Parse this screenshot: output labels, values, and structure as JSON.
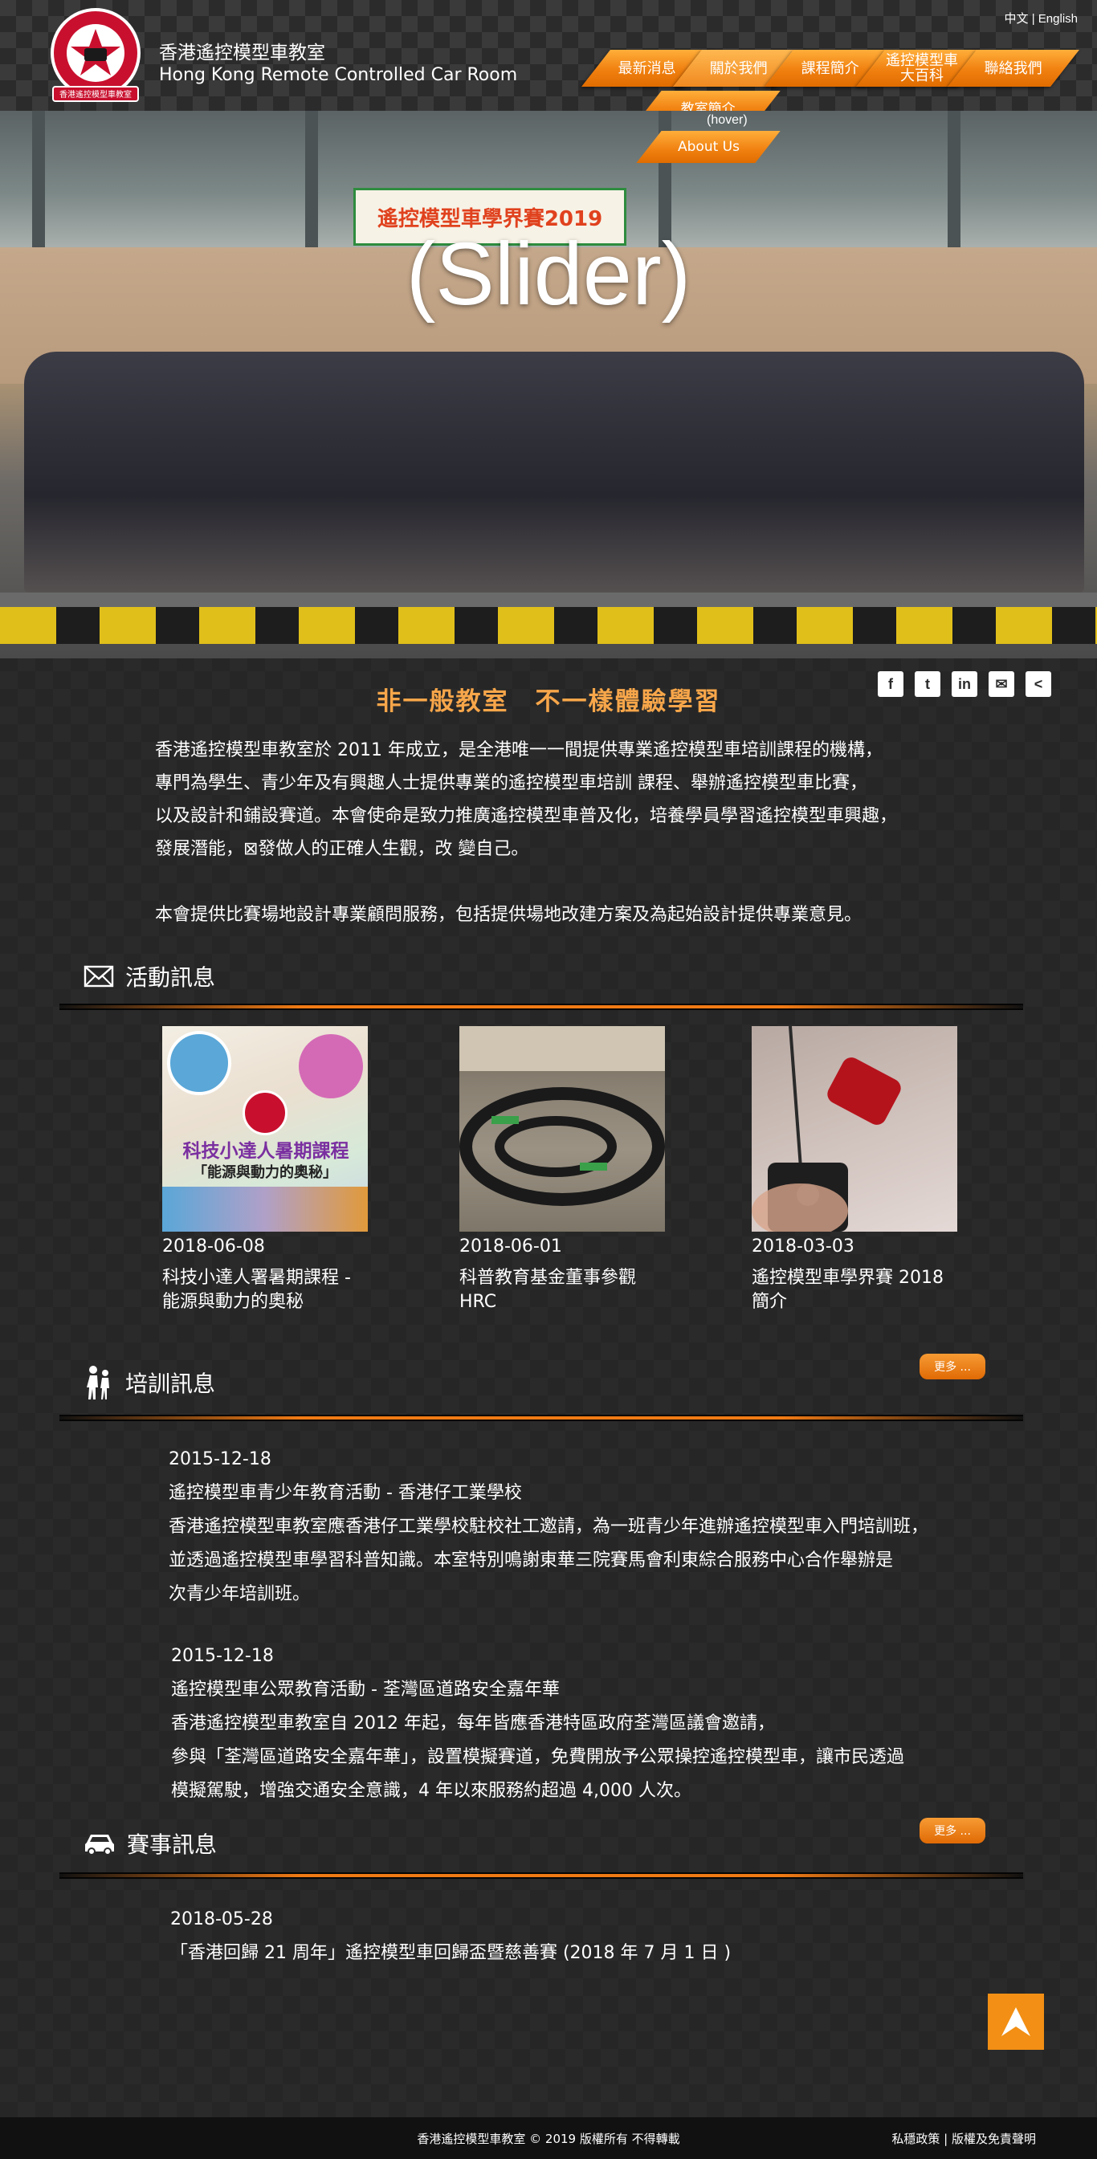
{
  "header": {
    "title_zh": "香港遙控模型車教室",
    "title_en": "Hong Kong Remote Controlled Car Room",
    "lang_zh": "中文",
    "lang_sep": "|",
    "lang_en": "English",
    "logo_text_top": "HONG KONG REMOTE CONTROLLED CAR ROOM",
    "logo_text_bottom": "香港遙控模型車教室"
  },
  "nav": {
    "items": [
      {
        "label": "最新消息"
      },
      {
        "label": "關於我們"
      },
      {
        "label": "課程簡介"
      },
      {
        "label": "遙控模型車\n大百科"
      },
      {
        "label": "聯絡我們"
      }
    ],
    "submenu": [
      {
        "label": "教室簡介"
      },
      {
        "label": "About Us"
      }
    ],
    "hover_note": "(hover)"
  },
  "slider": {
    "label": "(Slider)",
    "banner_text": "遙控模型車學界賽2019"
  },
  "intro": {
    "heading": "非一般教室　不一樣體驗學習",
    "lines": [
      "香港遙控模型車教室於 2011 年成立，是全港唯一一間提供專業遙控模型車培訓課程的機構，",
      "專門為學生、青少年及有興趣人士提供專業的遙控模型車培訓 課程、舉辦遙控模型車比賽，",
      "以及設計和鋪設賽道。本會使命是致力推廣遙控模型車普及化，培養學員學習遙控模型車興趣，",
      "發展潛能，⊠發做人的正確人生觀，改 變自己。"
    ],
    "line_extra": "本會提供比賽場地設計專業顧問服務，包括提供場地改建方案及為起始設計提供專業意見。"
  },
  "share": [
    "f",
    "t",
    "in",
    "✉",
    "<"
  ],
  "activities": {
    "title": "活動訊息",
    "more": "更多 ...",
    "items": [
      {
        "date": "2018-06-08",
        "title": "科技小達人署暑期課程 -\n能源與動力的奧秘",
        "thumb_text": "科技小達人暑期課程",
        "thumb_sub": "「能源與動力的奧秘」"
      },
      {
        "date": "2018-06-01",
        "title": "科普教育基金董事參觀\nHRC"
      },
      {
        "date": "2018-03-03",
        "title": "遙控模型車學界賽 2018\n簡介"
      }
    ]
  },
  "training": {
    "title": "培訓訊息",
    "more": "更多 ...",
    "items": [
      {
        "date": "2015-12-18",
        "title": "遙控模型車青少年教育活動 - 香港仔工業學校",
        "lines": [
          "香港遙控模型車教室應香港仔工業學校駐校社工邀請，為一班青少年進辦遙控模型車入門培訓班，",
          "並透過遙控模型車學習科普知識。本室特別鳴謝東華三院賽馬會利東綜合服務中心合作舉辦是",
          "次青少年培訓班。"
        ]
      },
      {
        "date": "2015-12-18",
        "title": "遙控模型車公眾教育活動 - 荃灣區道路安全嘉年華",
        "lines": [
          "香港遙控模型車教室自 2012 年起，每年皆應香港特區政府荃灣區議會邀請，",
          "參與「荃灣區道路安全嘉年華」，設置模擬賽道，免費開放予公眾操控遙控模型車，讓市民透過",
          "模擬駕駛，增強交通安全意識，4 年以來服務約超過 4,000 人次。"
        ]
      }
    ]
  },
  "races": {
    "title": "賽事訊息",
    "items": [
      {
        "date": "2018-05-28",
        "title": "「香港回歸 21 周年」遙控模型車回歸盃暨慈善賽 (2018 年 7 月 1 日 )"
      }
    ]
  },
  "footer": {
    "copyright": "香港遙控模型車教室 © 2019 版權所有 不得轉載",
    "privacy": "私穩政策",
    "sep": "|",
    "disclaimer": "版權及免責聲明"
  },
  "colors": {
    "accent": "#f08010",
    "heading": "#f7a64a"
  }
}
